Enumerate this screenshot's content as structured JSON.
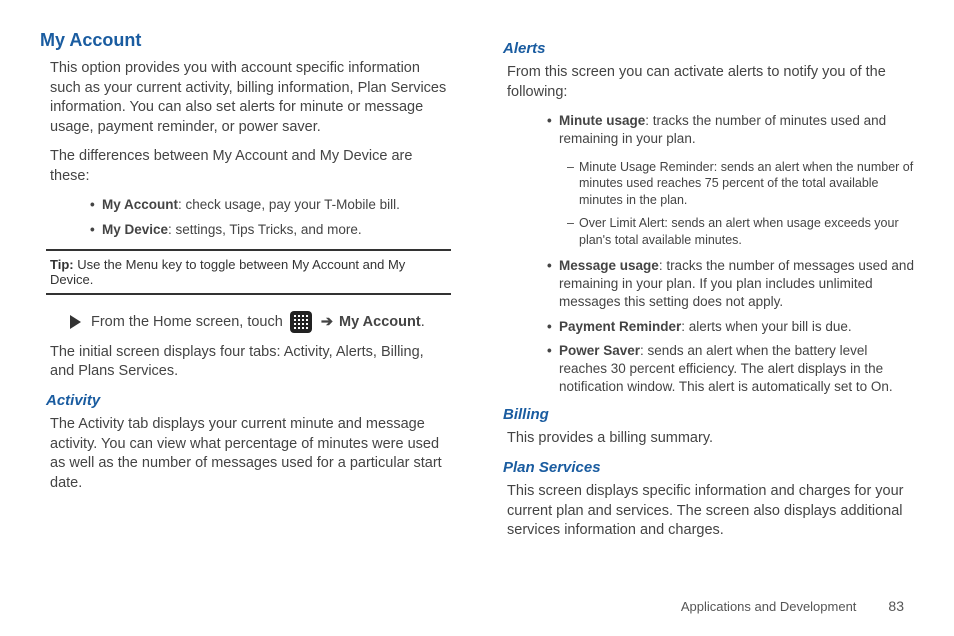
{
  "left": {
    "title": "My Account",
    "intro": "This option provides you with account specific information such as your current activity, billing information, Plan Services information. You can also set alerts for minute or message usage, payment reminder, or power saver.",
    "diff_intro": "The differences between My Account and My Device are these:",
    "diffs": [
      {
        "label": "My Account",
        "text": ": check usage, pay your T-Mobile bill."
      },
      {
        "label": "My Device",
        "text": ": settings, Tips Tricks, and more."
      }
    ],
    "tip_label": "Tip:",
    "tip_text": " Use the Menu key to toggle between My Account and My Device.",
    "step_pre": "From the Home screen, touch ",
    "step_arrow": "➔",
    "step_target": " My Account",
    "step_post": ".",
    "tabs_text": "The initial screen displays four tabs: Activity, Alerts, Billing, and Plans Services.",
    "activity": {
      "heading": "Activity",
      "text": "The Activity tab displays your current minute and message activity. You can view what percentage of minutes were used as well as the number of messages used for a particular start date."
    }
  },
  "right": {
    "alerts": {
      "heading": "Alerts",
      "intro": "From this screen you can activate alerts to notify you of the following:",
      "minute": {
        "label": "Minute usage",
        "text": ": tracks the number of minutes used and remaining in your plan."
      },
      "minute_sub": [
        "Minute Usage Reminder: sends an alert when the number of minutes used reaches 75 percent of the total available minutes in the plan.",
        "Over Limit Alert: sends an alert when usage exceeds your plan's total available minutes."
      ],
      "message": {
        "label": "Message usage",
        "text": ": tracks the number of messages used and remaining in your plan. If you plan includes unlimited messages this setting does not apply."
      },
      "payment": {
        "label": "Payment Reminder",
        "text": ": alerts when your bill is due."
      },
      "power": {
        "label": "Power Saver",
        "text": ": sends an alert when the battery level reaches 30 percent efficiency. The alert displays in the notification window. This alert is automatically set to On."
      }
    },
    "billing": {
      "heading": "Billing",
      "text": "This provides a billing summary."
    },
    "plan": {
      "heading": "Plan Services",
      "text": "This screen displays specific information and charges for your current plan and services. The screen also displays additional services information and charges."
    }
  },
  "footer": {
    "section": "Applications and Development",
    "page": "83"
  }
}
